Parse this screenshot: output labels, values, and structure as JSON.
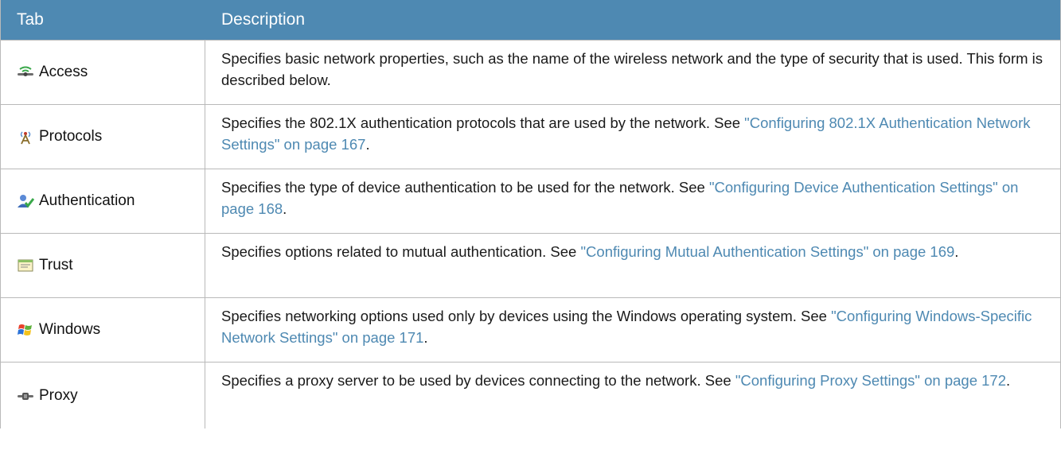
{
  "header": {
    "col_tab": "Tab",
    "col_description": "Description"
  },
  "rows": [
    {
      "tab": "Access",
      "icon": "access-antenna-icon",
      "text": "Specifies basic network properties, such as the name of the wireless network and the type of security that is used. This form is described below.",
      "link": "",
      "after": ""
    },
    {
      "tab": "Protocols",
      "icon": "protocols-tower-icon",
      "text": "Specifies the 802.1X authentication protocols that are used by the network. See ",
      "link": "\"Configuring 802.1X Authentication Network Settings\" on page 167",
      "after": "."
    },
    {
      "tab": "Authentication",
      "icon": "authentication-user-check-icon",
      "text": "Specifies the type of device authentication to be used for the network. See ",
      "link": "\"Configuring Device Authentication Settings\" on page 168",
      "after": "."
    },
    {
      "tab": "Trust",
      "icon": "trust-certificate-icon",
      "text": "Specifies options related to mutual authentication. See ",
      "link": "\"Configuring Mutual Authentication Settings\" on page 169",
      "after": "."
    },
    {
      "tab": "Windows",
      "icon": "windows-logo-icon",
      "text": "Specifies networking options used only by devices using the Windows operating system. See ",
      "link": "\"Configuring Windows-Specific Network Settings\" on page 171",
      "after": "."
    },
    {
      "tab": "Proxy",
      "icon": "proxy-connector-icon",
      "text": "Specifies a proxy server to be used by devices connecting to the network. See ",
      "link": "\"Configuring Proxy Settings\" on page 172",
      "after": "."
    }
  ],
  "colors": {
    "header_bg": "#4e89b2",
    "link": "#4e89b2",
    "border": "#b9b9b9"
  }
}
